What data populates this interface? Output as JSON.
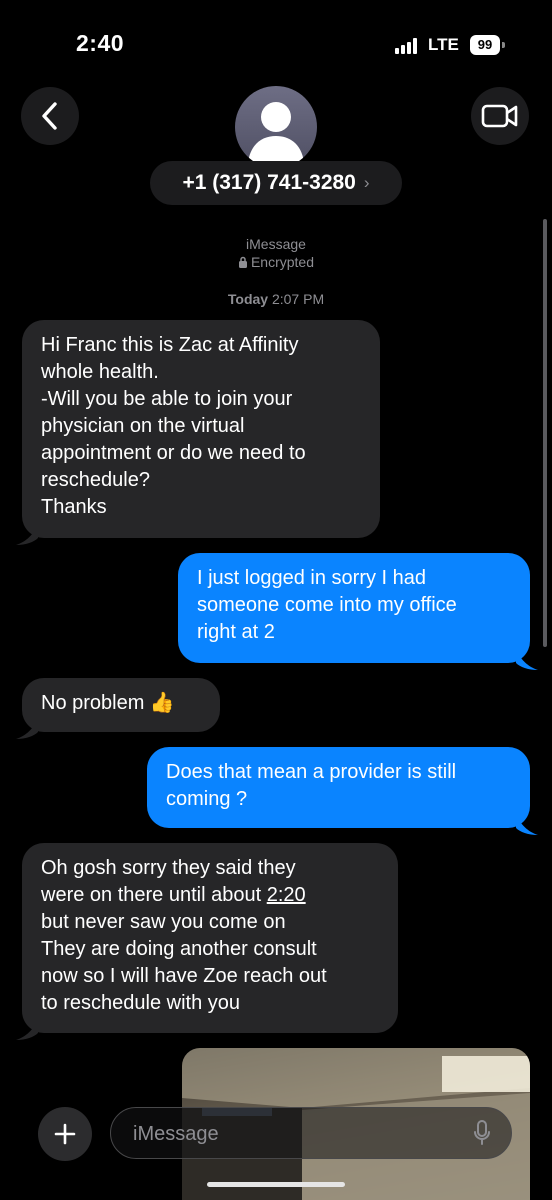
{
  "status": {
    "time": "2:40",
    "network": "LTE",
    "battery": "99"
  },
  "header": {
    "contact_number": "+1 (317) 741-3280",
    "chevron": "›"
  },
  "meta": {
    "service": "iMessage",
    "encryption": "Encrypted",
    "day": "Today",
    "time": "2:07 PM"
  },
  "messages": [
    {
      "direction": "received",
      "lines": [
        "Hi Franc this is Zac at Affinity",
        "whole health.",
        "-Will you be able to join your",
        "physician on the virtual",
        "appointment or do we need to",
        "reschedule?",
        "Thanks"
      ]
    },
    {
      "direction": "sent",
      "lines": [
        "I just logged in sorry I had",
        "someone come into my office",
        "right at 2"
      ]
    },
    {
      "direction": "received",
      "lines": [
        "No problem 👍"
      ]
    },
    {
      "direction": "sent",
      "lines": [
        "Does that mean a provider is still",
        "coming ?"
      ]
    },
    {
      "direction": "received",
      "lines": [
        "Oh gosh sorry they said they",
        "were on there until about",
        "2:20",
        "but never saw you come on",
        "They are doing another consult",
        "now so I will have Zoe reach out",
        "to reschedule with you"
      ]
    },
    {
      "direction": "received",
      "type": "image"
    }
  ],
  "composer": {
    "placeholder": "iMessage"
  },
  "colors": {
    "sent_bubble": "#0a84ff",
    "received_bubble": "#262628",
    "background": "#000000"
  },
  "icons": [
    "back-chevron-icon",
    "person-avatar-icon",
    "video-camera-icon",
    "lock-icon",
    "plus-icon",
    "microphone-icon"
  ]
}
